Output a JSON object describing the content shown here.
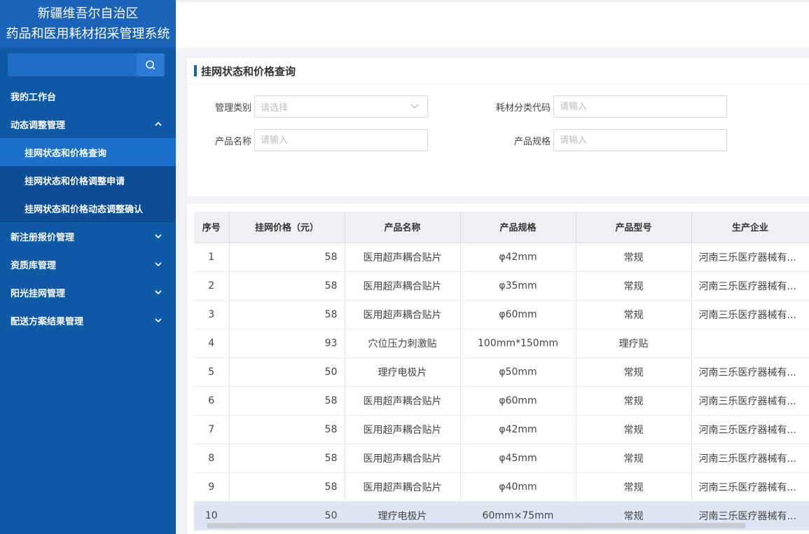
{
  "sidebar": {
    "title_line1": "新疆维吾尔自治区",
    "title_line2": "药品和医用耗材招采管理系统",
    "search_placeholder": "",
    "items": [
      {
        "label": "我的工作台"
      },
      {
        "label": "动态调整管理",
        "expanded": true,
        "children": [
          {
            "label": "挂网状态和价格查询",
            "active": true
          },
          {
            "label": "挂网状态和价格调整申请"
          },
          {
            "label": "挂网状态和价格动态调整确认"
          }
        ]
      },
      {
        "label": "新注册报价管理"
      },
      {
        "label": "资质库管理"
      },
      {
        "label": "阳光挂网管理"
      },
      {
        "label": "配送方案结果管理"
      }
    ]
  },
  "panel": {
    "title": "挂网状态和价格查询",
    "fields": {
      "category": {
        "label": "管理类别",
        "placeholder": "请选择"
      },
      "code": {
        "label": "耗材分类代码",
        "placeholder": "请输入"
      },
      "name": {
        "label": "产品名称",
        "placeholder": "请输入"
      },
      "spec": {
        "label": "产品规格",
        "placeholder": "请输入"
      }
    }
  },
  "table": {
    "columns": [
      "序号",
      "挂网价格（元）",
      "产品名称",
      "产品规格",
      "产品型号",
      "生产企业"
    ],
    "rows": [
      [
        "1",
        "58",
        "医用超声耦合贴片",
        "φ42mm",
        "常规",
        "河南三乐医疗器械有..."
      ],
      [
        "2",
        "58",
        "医用超声耦合贴片",
        "φ35mm",
        "常规",
        "河南三乐医疗器械有..."
      ],
      [
        "3",
        "58",
        "医用超声耦合贴片",
        "φ60mm",
        "常规",
        "河南三乐医疗器械有..."
      ],
      [
        "4",
        "93",
        "穴位压力刺激贴",
        "100mm*150mm",
        "理疗贴",
        ""
      ],
      [
        "5",
        "50",
        "理疗电极片",
        "φ50mm",
        "常规",
        "河南三乐医疗器械有..."
      ],
      [
        "6",
        "58",
        "医用超声耦合贴片",
        "φ60mm",
        "常规",
        "河南三乐医疗器械有..."
      ],
      [
        "7",
        "58",
        "医用超声耦合贴片",
        "φ42mm",
        "常规",
        "河南三乐医疗器械有..."
      ],
      [
        "8",
        "58",
        "医用超声耦合贴片",
        "φ45mm",
        "常规",
        "河南三乐医疗器械有..."
      ],
      [
        "9",
        "58",
        "医用超声耦合贴片",
        "φ40mm",
        "常规",
        "河南三乐医疗器械有..."
      ],
      [
        "10",
        "50",
        "理疗电极片",
        "60mm×75mm",
        "常规",
        "河南三乐医疗器械有..."
      ]
    ]
  }
}
